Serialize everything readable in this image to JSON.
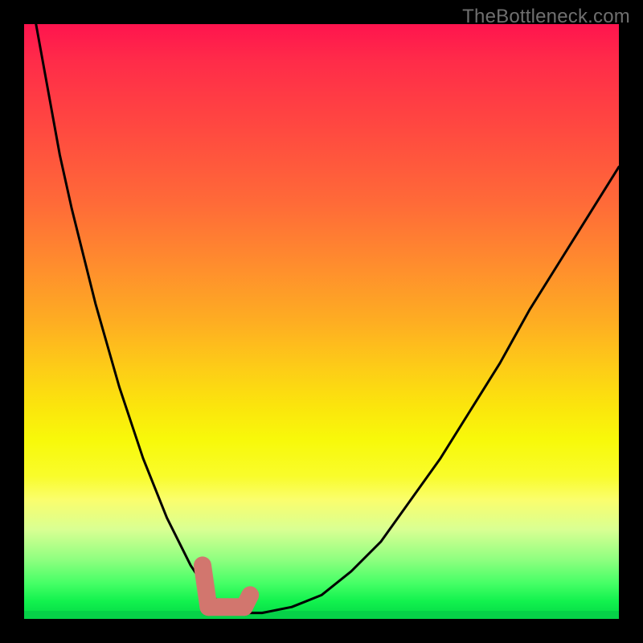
{
  "watermark": "TheBottleneck.com",
  "colors": {
    "background": "#000000",
    "gradient_top": "#ff144e",
    "gradient_bottom": "#06d544",
    "curve_stroke": "#000000",
    "highlight": "#d2766e"
  },
  "chart_data": {
    "type": "line",
    "title": "",
    "xlabel": "",
    "ylabel": "",
    "xlim": [
      0,
      100
    ],
    "ylim": [
      0,
      100
    ],
    "grid": false,
    "legend": false,
    "annotations": [],
    "series": [
      {
        "name": "bottleneck-curve",
        "x": [
          2,
          4,
          6,
          8,
          10,
          12,
          14,
          16,
          18,
          20,
          22,
          24,
          26,
          28,
          30,
          32,
          34,
          36,
          38,
          40,
          45,
          50,
          55,
          60,
          65,
          70,
          75,
          80,
          85,
          90,
          95,
          100
        ],
        "y": [
          100,
          89,
          78,
          69,
          61,
          53,
          46,
          39,
          33,
          27,
          22,
          17,
          13,
          9,
          6,
          3.5,
          2,
          1,
          1,
          1,
          2,
          4,
          8,
          13,
          20,
          27,
          35,
          43,
          52,
          60,
          68,
          76
        ]
      }
    ],
    "highlight_segment": {
      "xmin": 30,
      "xmax": 38
    }
  }
}
